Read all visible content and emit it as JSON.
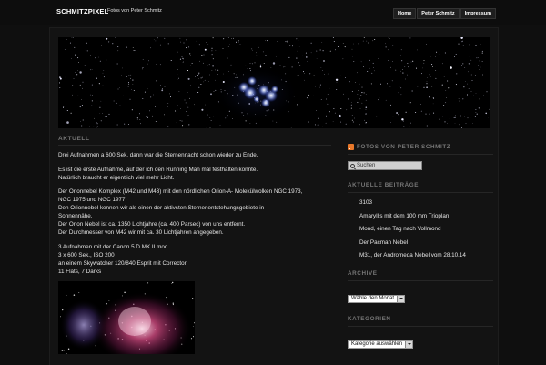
{
  "site": {
    "title": "SCHMITZPIXEL",
    "description": "Fotos von Peter Schmitz"
  },
  "nav": {
    "items": [
      "Home",
      "Peter Schmitz",
      "Impressum"
    ]
  },
  "content": {
    "heading": "AKTUELL",
    "paragraphs": [
      [
        "Drei Aufnahmen a 600 Sek. dann war die Sternennacht schon wieder zu Ende."
      ],
      [
        "Es ist die erste Aufnahme, auf der ich den Running Man mal festhalten konnte.",
        "Natürlich braucht er eigentlich viel mehr Licht."
      ],
      [
        "Der Orionnebel Komplex (M42 und M43) mit den nördlichen Orion-A- Molekülwolken NGC 1973,",
        "NGC 1975 und NGC 1977.",
        "Den Orionnebel kennen wir als einen der aktivsten Sternenentstehungsgebiete in",
        "Sonnennähe.",
        "Der Orion Nebel ist ca. 1350 Lichtjahre (ca. 400 Parsec) von uns entfernt.",
        "Der Durchmesser von M42 wir mit ca. 30 Lichtjahren angegeben."
      ],
      [
        "3 Aufnahmen mit der Canon 5 D MK II mod.",
        "3 x 600 Sek., ISO 200",
        "an einem Skywatcher 120/840 Esprit mit Corrector",
        "11 Flats, 7 Darks"
      ]
    ]
  },
  "sidebar": {
    "feed_title": "FOTOS VON PETER SCHMITZ",
    "search_placeholder": "Suchen",
    "recent_title": "AKTUELLE BEITRÄGE",
    "recent_posts": [
      "3103",
      "Amaryllis mit dem 100 mm Trioplan",
      "Mond, einen Tag nach Vollmond",
      "Der Pacman Nebel",
      "M31, der Andromeda Nebel vom 28.10.14"
    ],
    "archive_title": "ARCHIVE",
    "archive_select": "Wähle den Monat",
    "categories_title": "KATEGORIEN",
    "categories_select": "Kategorie auswählen"
  },
  "icons": {
    "rss": "rss-icon",
    "search": "search-icon",
    "dropdown": "chevron-down-icon"
  },
  "colors": {
    "background": "#0f0f0f",
    "panel": "#131313",
    "heading_gray": "#777777",
    "rss_orange": "#e8782a"
  }
}
